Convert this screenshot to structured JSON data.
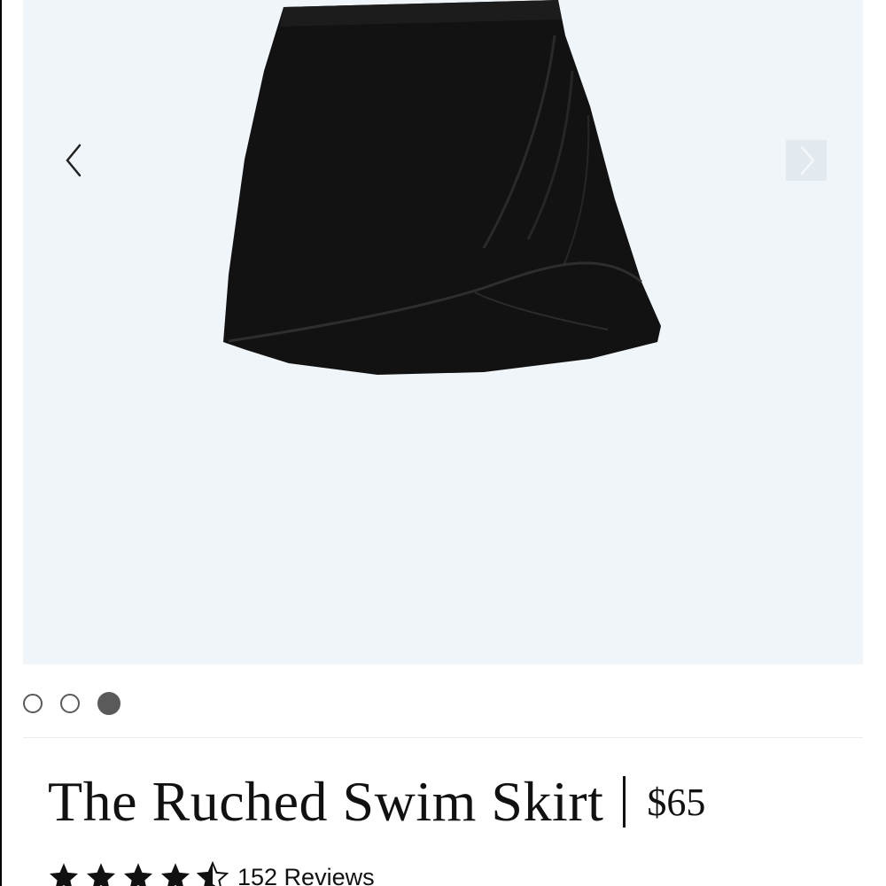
{
  "gallery": {
    "image_subject": "black-ruched-swim-skirt",
    "background_color": "#eff5f9",
    "prev_icon": "chevron-left-icon",
    "next_icon": "chevron-right-icon",
    "slide_count": 3,
    "active_slide": 3
  },
  "product": {
    "title": "The Ruched Swim Skirt",
    "separator": "|",
    "price": "$65"
  },
  "rating": {
    "stars": 4.5,
    "max_stars": 5,
    "star_icon": "star-icon",
    "reviews_label": "152 Reviews"
  },
  "colors": {
    "text": "#111111",
    "dot": "#5a5a5a",
    "skirt": "#121212"
  }
}
